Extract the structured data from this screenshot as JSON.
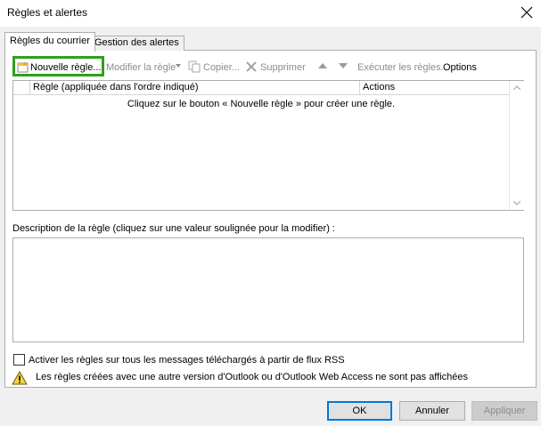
{
  "window": {
    "title": "Règles et alertes"
  },
  "tabs": [
    {
      "label": "Règles du courrier",
      "active": true
    },
    {
      "label": "Gestion des alertes",
      "active": false
    }
  ],
  "toolbar": {
    "new_rule": "Nouvelle règle...",
    "modify_rule": "Modifier la règle",
    "copy": "Copier...",
    "delete": "Supprimer",
    "run_rules": "Exécuter les règles...",
    "options": "Options"
  },
  "rules_list": {
    "columns": [
      "Règle (appliquée dans l'ordre indiqué)",
      "Actions"
    ],
    "empty_message": "Cliquez sur le bouton « Nouvelle règle » pour créer une règle."
  },
  "description": {
    "label": "Description de la règle (cliquez sur une valeur soulignée pour la modifier) :"
  },
  "rss_checkbox": {
    "label": "Activer les règles sur tous les messages téléchargés à partir de flux RSS",
    "checked": false
  },
  "warning": {
    "text": "Les règles créées avec une autre version d'Outlook ou d'Outlook Web Access ne sont pas affichées"
  },
  "buttons": {
    "ok": "OK",
    "cancel": "Annuler",
    "apply": "Appliquer"
  },
  "colors": {
    "highlight": "#2ea01a",
    "default_button_border": "#0078d7"
  }
}
